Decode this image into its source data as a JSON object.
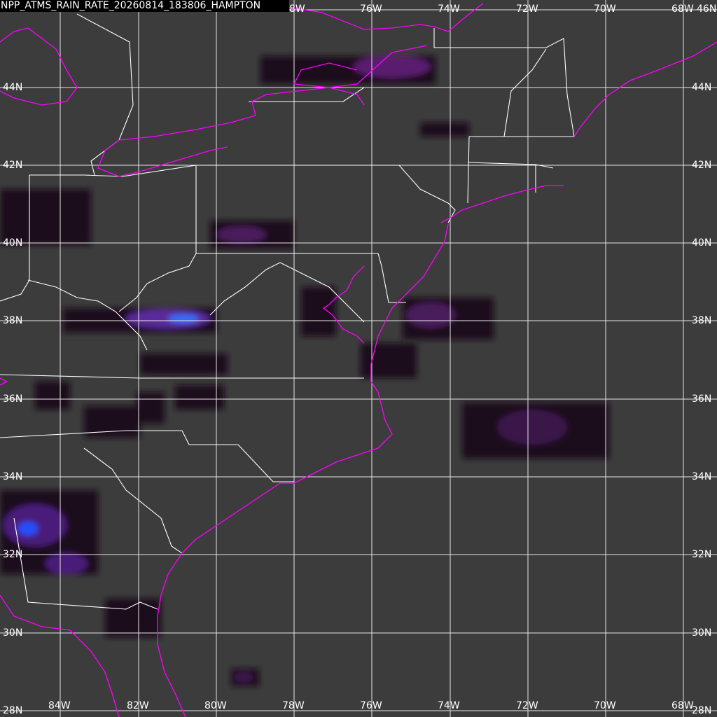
{
  "title": "NPP_ATMS_RAIN_RATE_20260814_183806_HAMPTON",
  "colors": {
    "background": "#3c3c3c",
    "grid": "#e6e6e6",
    "coastline": "#ff00ff",
    "borders": "#ffffff",
    "rain_low": "#2a0a2a",
    "rain_mid": "#7a2a9a",
    "rain_high": "#2050ff"
  },
  "longitude_labels": [
    "84W",
    "82W",
    "80W",
    "78W",
    "76W",
    "74W",
    "72W",
    "70W",
    "68W"
  ],
  "latitude_labels": [
    "28N",
    "30N",
    "32N",
    "34N",
    "36N",
    "38N",
    "40N",
    "42N",
    "44N",
    "46N"
  ],
  "top_labels": [
    "8W",
    "76W",
    "74W",
    "72W",
    "70W",
    "68W"
  ],
  "icons": {
    "grid": "graticule-lines",
    "coast": "coastline-path",
    "rain": "rain-rate-cell"
  }
}
